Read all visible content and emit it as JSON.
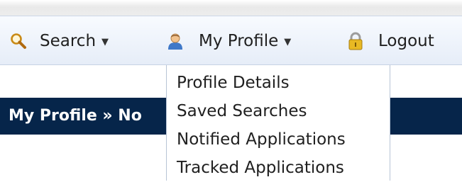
{
  "nav": {
    "search": {
      "label": "Search",
      "icon": "search-icon"
    },
    "profile": {
      "label": "My Profile",
      "icon": "user-icon"
    },
    "logout": {
      "label": "Logout",
      "icon": "lock-icon"
    }
  },
  "page_header": {
    "title": "My Profile » No"
  },
  "dropdown": {
    "items": [
      "Profile Details",
      "Saved Searches",
      "Notified Applications",
      "Tracked Applications"
    ]
  },
  "colors": {
    "header_bg": "#06254a",
    "navbar_bg": "#eef3fb",
    "text": "#202020"
  }
}
